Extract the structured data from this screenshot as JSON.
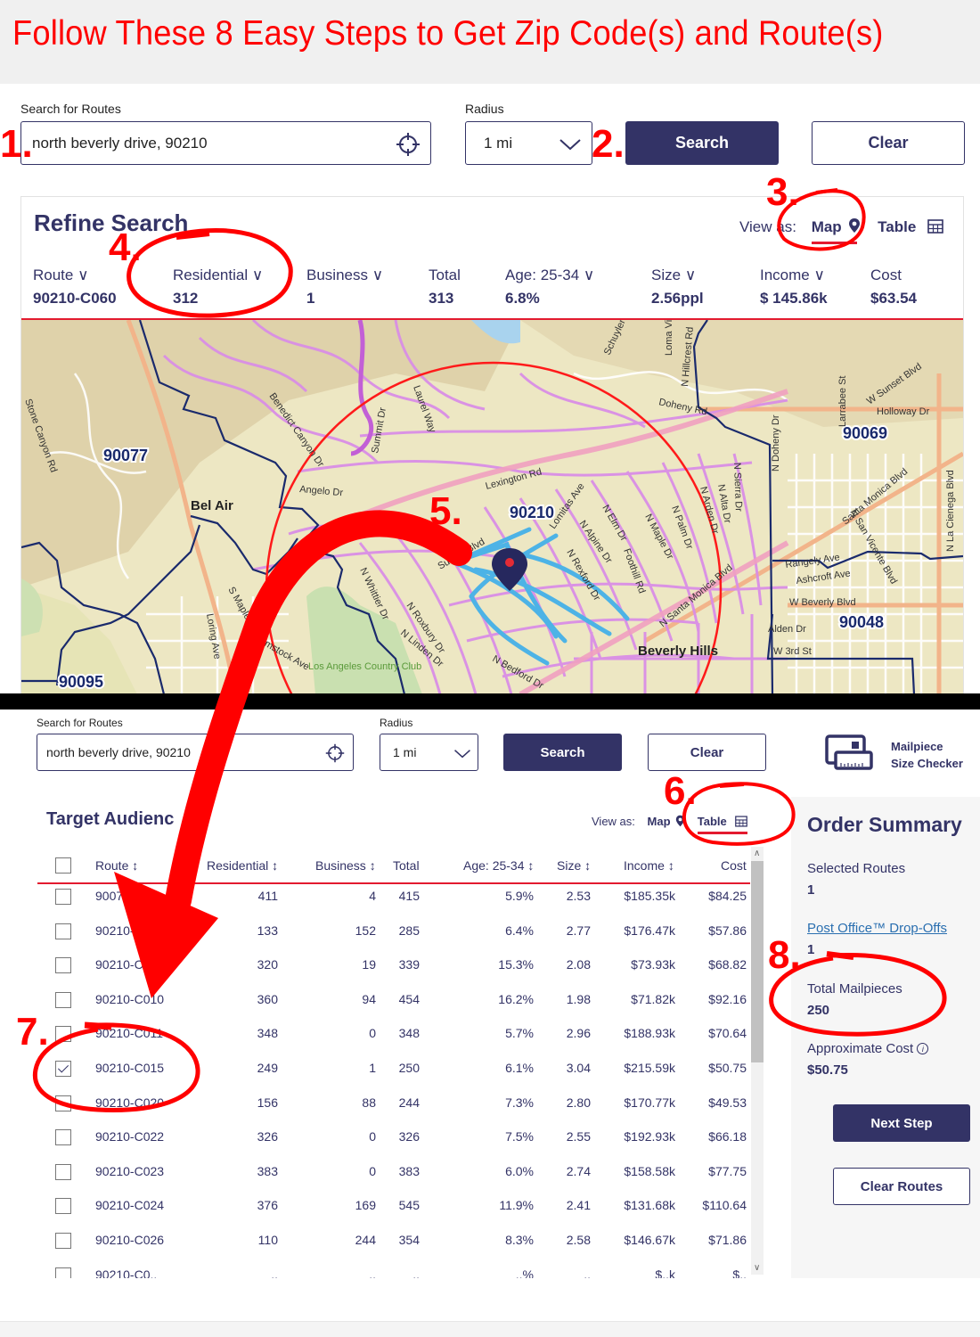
{
  "header": {
    "title": "Follow These 8 Easy Steps to Get Zip Code(s) and Route(s)"
  },
  "annotations": {
    "steps": [
      "1.",
      "2.",
      "3.",
      "4.",
      "5.",
      "6.",
      "7.",
      "8."
    ],
    "color": "#ff0000"
  },
  "top_panel": {
    "search_label": "Search for Routes",
    "search_value": "north beverly drive, 90210",
    "radius_label": "Radius",
    "radius_value": "1 mi",
    "search_button": "Search",
    "clear_button": "Clear",
    "refine": {
      "title": "Refine Search",
      "view_as_label": "View as:",
      "view_map": "Map",
      "view_table": "Table",
      "active_view": "Map",
      "stats": [
        {
          "label": "Route",
          "value": "90210-C060",
          "sortable": true
        },
        {
          "label": "Residential",
          "value": "312",
          "sortable": true
        },
        {
          "label": "Business",
          "value": "1",
          "sortable": true
        },
        {
          "label": "Total",
          "value": "313",
          "sortable": false
        },
        {
          "label": "Age: 25-34",
          "value": "6.8%",
          "sortable": true
        },
        {
          "label": "Size",
          "value": "2.56ppl",
          "sortable": true
        },
        {
          "label": "Income",
          "value": "$ 145.86k",
          "sortable": true
        },
        {
          "label": "Cost",
          "value": "$63.54",
          "sortable": false
        }
      ]
    },
    "map": {
      "zip_labels": [
        "90077",
        "90210",
        "90069",
        "90048",
        "90095"
      ],
      "place_labels": [
        "Bel Air",
        "Beverly Hills",
        "Los Angeles Country Club"
      ],
      "street_labels": [
        "Stone Canyon Rd",
        "Benedict Canyon Dr",
        "Laurel Way",
        "Summit Dr",
        "Lexington Rd",
        "Angelo Dr",
        "Sunset Blvd",
        "N Whittier Dr",
        "N Roxbury Dr",
        "N Linden Dr",
        "N Bedford Dr",
        "Lomitas Ave",
        "N Elm Dr",
        "N Maple Dr",
        "N Palm Dr",
        "N Alpine Dr",
        "N Rexford Dr",
        "Foothill Rd",
        "N Arden Dr",
        "N Alta Dr",
        "N Sierra Dr",
        "Doheny Rd",
        "N Doheny Dr",
        "W Sunset Blvd",
        "Holloway Dr",
        "Larrabee St",
        "Santa Monica Blvd",
        "N La Cienega Blvd",
        "N San Vicente Blvd",
        "Rangely Ave",
        "Ashcroft Ave",
        "W Beverly Blvd",
        "Alden Dr",
        "W 3rd St",
        "N Santa Monica Blvd",
        "S Mapleton Dr",
        "Loring Ave",
        "Comstock Ave",
        "Schuyler Rd",
        "N Hillcrest Rd",
        "Loma Vista Dr"
      ],
      "radius_circle_color": "#ff0000",
      "route_color": "#4db3e6",
      "zip_boundary_color": "#1a2a6c",
      "street_color": "#d98ee6"
    }
  },
  "bottom_panel": {
    "search_label": "Search for Routes",
    "search_value": "north beverly drive, 90210",
    "radius_label": "Radius",
    "radius_value": "1 mi",
    "search_button": "Search",
    "clear_button": "Clear",
    "mailpiece_checker": {
      "line1": "Mailpiece",
      "line2": "Size Checker"
    },
    "target_title": "Target Audienc",
    "view_as_label": "View as:",
    "view_map": "Map",
    "view_table": "Table",
    "active_view": "Table",
    "table": {
      "columns": [
        "Route",
        "Residential",
        "Business",
        "Total",
        "Age: 25-34",
        "Size",
        "Income",
        "Cost"
      ],
      "rows": [
        {
          "checked": false,
          "route": "90077-C0..",
          "residential": "411",
          "business": "4",
          "total": "415",
          "age": "5.9%",
          "size": "2.53",
          "income": "$185.35k",
          "cost": "$84.25"
        },
        {
          "checked": false,
          "route": "90210-C0..",
          "residential": "133",
          "business": "152",
          "total": "285",
          "age": "6.4%",
          "size": "2.77",
          "income": "$176.47k",
          "cost": "$57.86"
        },
        {
          "checked": false,
          "route": "90210-C0..",
          "residential": "320",
          "business": "19",
          "total": "339",
          "age": "15.3%",
          "size": "2.08",
          "income": "$73.93k",
          "cost": "$68.82"
        },
        {
          "checked": false,
          "route": "90210-C010",
          "residential": "360",
          "business": "94",
          "total": "454",
          "age": "16.2%",
          "size": "1.98",
          "income": "$71.82k",
          "cost": "$92.16"
        },
        {
          "checked": false,
          "route": "90210-C011",
          "residential": "348",
          "business": "0",
          "total": "348",
          "age": "5.7%",
          "size": "2.96",
          "income": "$188.93k",
          "cost": "$70.64"
        },
        {
          "checked": true,
          "route": "90210-C015",
          "residential": "249",
          "business": "1",
          "total": "250",
          "age": "6.1%",
          "size": "3.04",
          "income": "$215.59k",
          "cost": "$50.75"
        },
        {
          "checked": false,
          "route": "90210-C020",
          "residential": "156",
          "business": "88",
          "total": "244",
          "age": "7.3%",
          "size": "2.80",
          "income": "$170.77k",
          "cost": "$49.53"
        },
        {
          "checked": false,
          "route": "90210-C022",
          "residential": "326",
          "business": "0",
          "total": "326",
          "age": "7.5%",
          "size": "2.55",
          "income": "$192.93k",
          "cost": "$66.18"
        },
        {
          "checked": false,
          "route": "90210-C023",
          "residential": "383",
          "business": "0",
          "total": "383",
          "age": "6.0%",
          "size": "2.74",
          "income": "$158.58k",
          "cost": "$77.75"
        },
        {
          "checked": false,
          "route": "90210-C024",
          "residential": "376",
          "business": "169",
          "total": "545",
          "age": "11.9%",
          "size": "2.41",
          "income": "$131.68k",
          "cost": "$110.64"
        },
        {
          "checked": false,
          "route": "90210-C026",
          "residential": "110",
          "business": "244",
          "total": "354",
          "age": "8.3%",
          "size": "2.58",
          "income": "$146.67k",
          "cost": "$71.86"
        },
        {
          "checked": false,
          "route": "90210-C0..",
          "residential": "..",
          "business": "..",
          "total": "..",
          "age": "..%",
          "size": "..",
          "income": "$..k",
          "cost": "$.."
        }
      ]
    },
    "order_summary": {
      "title": "Order Summary",
      "selected_routes_label": "Selected Routes",
      "selected_routes_value": "1",
      "drop_offs_label": "Post Office™ Drop-Offs",
      "drop_offs_value": "1",
      "total_mailpieces_label": "Total Mailpieces",
      "total_mailpieces_value": "250",
      "approx_cost_label": "Approximate Cost",
      "approx_cost_value": "$50.75",
      "next_step_button": "Next Step",
      "clear_routes_button": "Clear Routes"
    }
  },
  "colors": {
    "brand_navy": "#333366",
    "rule_red": "#e31a2f",
    "annotation_red": "#ff0000",
    "link_blue": "#2a6fb0"
  }
}
